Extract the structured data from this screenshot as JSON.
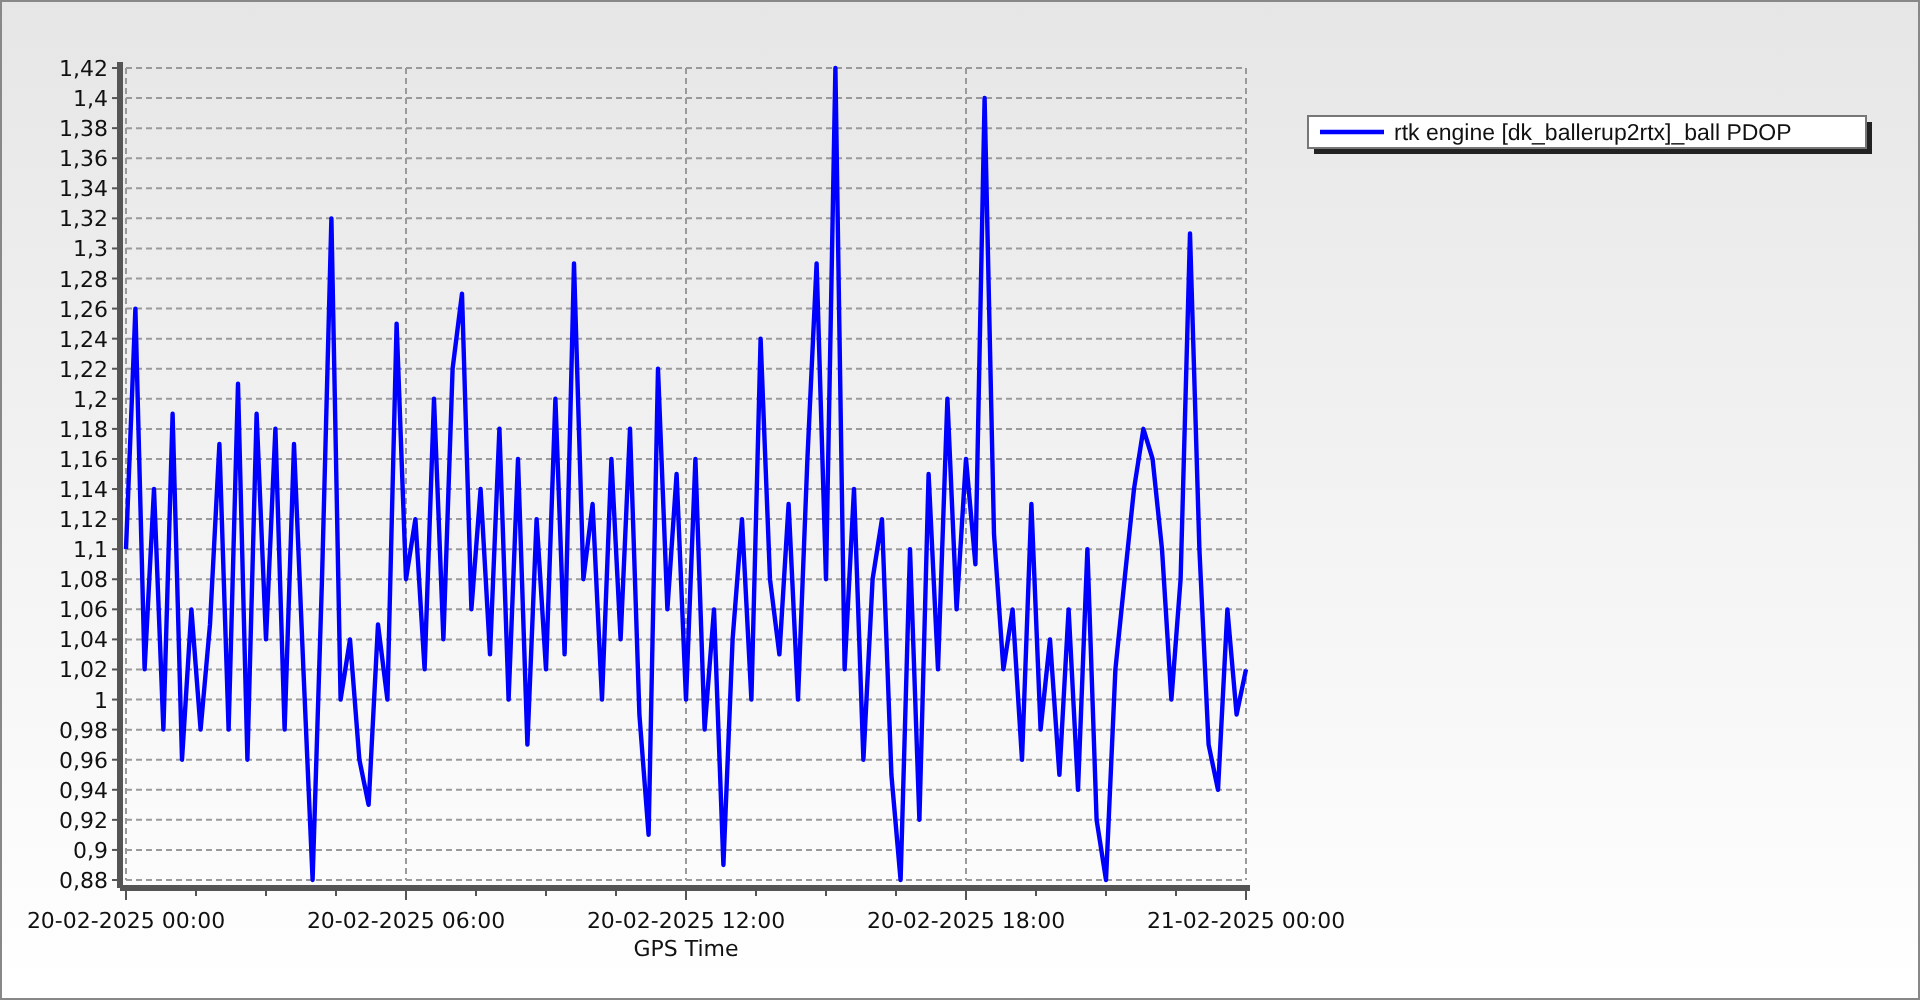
{
  "chart": {
    "chart_data": {
      "type": "line",
      "grid": true,
      "xlabel": "GPS Time",
      "ylim": [
        0.88,
        1.42
      ],
      "categories": [
        "20-02-2025 00:00",
        null,
        null,
        null,
        null,
        null,
        null,
        null,
        null,
        null,
        null,
        null,
        null,
        null,
        null,
        null,
        null,
        null,
        null,
        null,
        null,
        null,
        null,
        null,
        null,
        null,
        null,
        null,
        null,
        null,
        "20-02-2025 06:00",
        null,
        null,
        null,
        null,
        null,
        null,
        null,
        null,
        null,
        null,
        null,
        null,
        null,
        null,
        null,
        null,
        null,
        null,
        null,
        null,
        null,
        null,
        null,
        null,
        null,
        null,
        null,
        null,
        null,
        "20-02-2025 12:00",
        null,
        null,
        null,
        null,
        null,
        null,
        null,
        null,
        null,
        null,
        null,
        null,
        null,
        null,
        null,
        null,
        null,
        null,
        null,
        null,
        null,
        null,
        null,
        null,
        null,
        null,
        null,
        null,
        null,
        "20-02-2025 18:00",
        null,
        null,
        null,
        null,
        null,
        null,
        null,
        null,
        null,
        null,
        null,
        null,
        null,
        null,
        null,
        null,
        null,
        null,
        null,
        null,
        null,
        null,
        null,
        null,
        null,
        null,
        null,
        null,
        null,
        "21-02-2025 00:00"
      ],
      "yticks": [
        {
          "value": 0.88,
          "label": "0,88"
        },
        {
          "value": 0.9,
          "label": "0,9"
        },
        {
          "value": 0.92,
          "label": "0,92"
        },
        {
          "value": 0.94,
          "label": "0,94"
        },
        {
          "value": 0.96,
          "label": "0,96"
        },
        {
          "value": 0.98,
          "label": "0,98"
        },
        {
          "value": 1,
          "label": "1"
        },
        {
          "value": 1.02,
          "label": "1,02"
        },
        {
          "value": 1.04,
          "label": "1,04"
        },
        {
          "value": 1.06,
          "label": "1,06"
        },
        {
          "value": 1.08,
          "label": "1,08"
        },
        {
          "value": 1.1,
          "label": "1,1"
        },
        {
          "value": 1.12,
          "label": "1,12"
        },
        {
          "value": 1.14,
          "label": "1,14"
        },
        {
          "value": 1.16,
          "label": "1,16"
        },
        {
          "value": 1.18,
          "label": "1,18"
        },
        {
          "value": 1.2,
          "label": "1,2"
        },
        {
          "value": 1.22,
          "label": "1,22"
        },
        {
          "value": 1.24,
          "label": "1,24"
        },
        {
          "value": 1.26,
          "label": "1,26"
        },
        {
          "value": 1.28,
          "label": "1,28"
        },
        {
          "value": 1.3,
          "label": "1,3"
        },
        {
          "value": 1.32,
          "label": "1,32"
        },
        {
          "value": 1.34,
          "label": "1,34"
        },
        {
          "value": 1.36,
          "label": "1,36"
        },
        {
          "value": 1.38,
          "label": "1,38"
        },
        {
          "value": 1.4,
          "label": "1,4"
        },
        {
          "value": 1.42,
          "label": "1,42"
        }
      ],
      "series": [
        {
          "name": "rtk engine [dk_ballerup2rtx]_ball PDOP",
          "color": "#0000ff",
          "values": [
            1.1,
            1.26,
            1.02,
            1.14,
            0.98,
            1.19,
            0.96,
            1.06,
            0.98,
            1.05,
            1.17,
            0.98,
            1.21,
            0.96,
            1.19,
            1.04,
            1.18,
            0.98,
            1.17,
            1.02,
            0.88,
            1.08,
            1.32,
            1.0,
            1.04,
            0.96,
            0.93,
            1.05,
            1.0,
            1.25,
            1.08,
            1.12,
            1.02,
            1.2,
            1.04,
            1.22,
            1.27,
            1.06,
            1.14,
            1.03,
            1.18,
            1.0,
            1.16,
            0.97,
            1.12,
            1.02,
            1.2,
            1.03,
            1.29,
            1.08,
            1.13,
            1.0,
            1.16,
            1.04,
            1.18,
            0.99,
            0.91,
            1.22,
            1.06,
            1.15,
            1.0,
            1.16,
            0.98,
            1.06,
            0.89,
            1.04,
            1.12,
            1.0,
            1.24,
            1.08,
            1.03,
            1.13,
            1.0,
            1.16,
            1.29,
            1.08,
            1.42,
            1.02,
            1.14,
            0.96,
            1.08,
            1.12,
            0.95,
            0.88,
            1.1,
            0.92,
            1.15,
            1.02,
            1.2,
            1.06,
            1.16,
            1.09,
            1.4,
            1.11,
            1.02,
            1.06,
            0.96,
            1.13,
            0.98,
            1.04,
            0.95,
            1.06,
            0.94,
            1.1,
            0.92,
            0.88,
            1.02,
            1.08,
            1.14,
            1.18,
            1.16,
            1.1,
            1.0,
            1.08,
            1.31,
            1.1,
            0.97,
            0.94,
            1.06,
            0.99,
            1.02
          ]
        }
      ]
    }
  }
}
